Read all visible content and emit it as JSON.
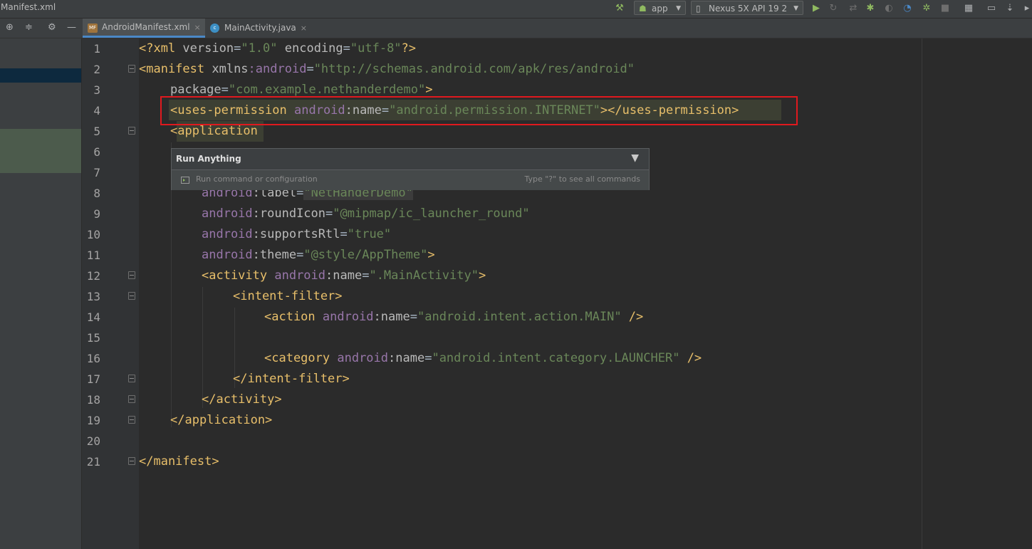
{
  "window": {
    "title": "Manifest.xml"
  },
  "toolbar": {
    "run_config": "app",
    "device": "Nexus 5X API 19 2"
  },
  "tabs": [
    {
      "label": "AndroidManifest.xml",
      "close": "×",
      "icon": "xml-file-icon"
    },
    {
      "label": "MainActivity.java",
      "close": "×",
      "icon": "java-class-icon"
    }
  ],
  "editor": {
    "line_numbers": [
      "1",
      "2",
      "3",
      "4",
      "5",
      "6",
      "7",
      "8",
      "9",
      "10",
      "11",
      "12",
      "13",
      "14",
      "15",
      "16",
      "17",
      "18",
      "19",
      "20",
      "21"
    ],
    "lines": {
      "l1": {
        "pi_open": "<?xml",
        "v_attr": " version",
        "eq": "=",
        "v_val": "\"1.0\"",
        "e_attr": " encoding",
        "eq2": "=",
        "e_val": "\"utf-8\"",
        "pi_close": "?>"
      },
      "l2": {
        "tag": "<manifest",
        "attr": " xmlns",
        "colon_ns": ":android",
        "eq": "=",
        "val": "\"http://schemas.android.com/apk/res/android\""
      },
      "l3": {
        "attr": "package",
        "eq": "=",
        "val": "\"com.example.nethanderdemo\"",
        "close": ">"
      },
      "l4": {
        "tag": "<uses-permission",
        "ns": " android",
        "attr": ":name",
        "eq": "=",
        "val": "\"android.permission.INTERNET\"",
        "close": "></uses-permission>"
      },
      "l5": {
        "tag_lt": "<",
        "tag": "application"
      },
      "l8": {
        "ns": "android",
        "attr": ":label",
        "eq": "=",
        "val": "\"NetHanderDemo\""
      },
      "l9": {
        "ns": "android",
        "attr": ":roundIcon",
        "eq": "=",
        "val": "\"@mipmap/ic_launcher_round\""
      },
      "l10": {
        "ns": "android",
        "attr": ":supportsRtl",
        "eq": "=",
        "val": "\"true\""
      },
      "l11": {
        "ns": "android",
        "attr": ":theme",
        "eq": "=",
        "val": "\"@style/AppTheme\"",
        "close": ">"
      },
      "l12": {
        "tag": "<activity",
        "ns": " android",
        "attr": ":name",
        "eq": "=",
        "val": "\".MainActivity\"",
        "close": ">"
      },
      "l13": {
        "tag": "<intent-filter>"
      },
      "l14": {
        "tag": "<action",
        "ns": " android",
        "attr": ":name",
        "eq": "=",
        "val": "\"android.intent.action.MAIN\"",
        "close": " />"
      },
      "l16": {
        "tag": "<category",
        "ns": " android",
        "attr": ":name",
        "eq": "=",
        "val": "\"android.intent.category.LAUNCHER\"",
        "close": " />"
      },
      "l17": {
        "tag": "</intent-filter>"
      },
      "l18": {
        "tag": "</activity>"
      },
      "l19": {
        "tag": "</application>"
      },
      "l21": {
        "tag": "</manifest>"
      }
    }
  },
  "popup": {
    "title": "Run Anything",
    "placeholder": "Run command or configuration",
    "hint": "Type \"?\" to see all commands"
  },
  "colors": {
    "highlight_box": "#e0191e",
    "tag": "#e8bf6a",
    "value": "#6a8759",
    "namespace": "#9876aa"
  }
}
